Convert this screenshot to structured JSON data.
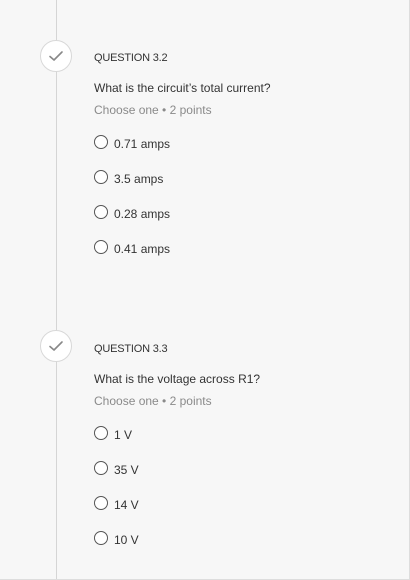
{
  "questions": [
    {
      "title": "QUESTION 3.2",
      "text": "What is the circuit’s total current?",
      "meta": "Choose one • 2 points",
      "options": [
        "0.71 amps",
        "3.5 amps",
        "0.28 amps",
        "0.41 amps"
      ]
    },
    {
      "title": "QUESTION 3.3",
      "text": "What is the voltage across R1?",
      "meta": "Choose one • 2 points",
      "options": [
        "1 V",
        "35 V",
        "14 V",
        "10 V"
      ]
    }
  ]
}
